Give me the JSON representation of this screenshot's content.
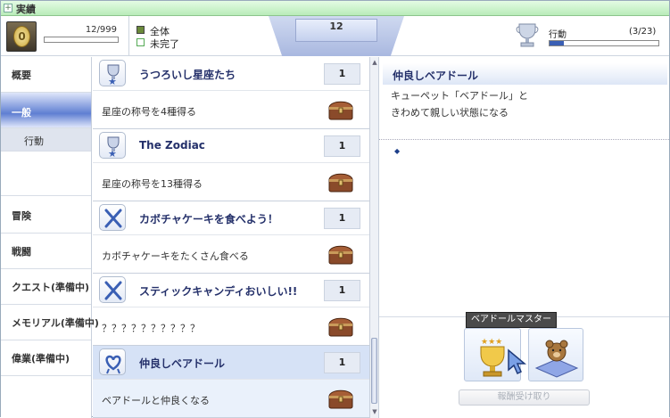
{
  "window": {
    "title": "実績"
  },
  "header": {
    "score": "12/999",
    "score_progress": 0.012,
    "filters": [
      {
        "label": "全体",
        "checked": true
      },
      {
        "label": "未完了",
        "checked": false
      }
    ],
    "center_value": "12",
    "category": {
      "label": "行動",
      "count": "(3/23)",
      "progress": 0.13
    }
  },
  "sidebar": {
    "items": [
      {
        "label": "概要"
      },
      {
        "label": "一般"
      },
      {
        "label": "行動"
      },
      {
        "label": ""
      },
      {
        "label": "冒険"
      },
      {
        "label": "戦闘"
      },
      {
        "label": "クエスト(準備中)"
      },
      {
        "label": "メモリアル(準備中)"
      },
      {
        "label": "偉業(準備中)"
      }
    ]
  },
  "achievements": [
    {
      "name": "うつろいし星座たち",
      "points": "1",
      "description": "星座の称号を4種得る",
      "icon": "star-trophy-icon"
    },
    {
      "name": "The Zodiac",
      "points": "1",
      "description": "星座の称号を13種得る",
      "icon": "star-trophy-icon"
    },
    {
      "name": "カボチャケーキを食べよう！",
      "points": "1",
      "description": "カボチャケーキをたくさん食べる",
      "icon": "fork-knife-icon"
    },
    {
      "name": "スティックキャンディおいしい!!",
      "points": "1",
      "description": "？？？？？？？？？？",
      "icon": "fork-knife-icon"
    },
    {
      "name": "仲良しベアドール",
      "points": "1",
      "description": "ベアドールと仲良くなる",
      "icon": "heart-ribbon-icon"
    }
  ],
  "detail": {
    "title": "仲良しベアドール",
    "desc_line1": "キューペット「ベアドール」と",
    "desc_line2": "きわめて親しい状態になる",
    "bullet": "◆",
    "tooltip": "ベアドールマスター",
    "claim_label": "報酬受け取り"
  },
  "colors": {
    "title_green": "#b9ecb9",
    "selected_blue": "#5f7fd2",
    "name_navy": "#24306a",
    "progress_blue": "#3a5fb4"
  }
}
